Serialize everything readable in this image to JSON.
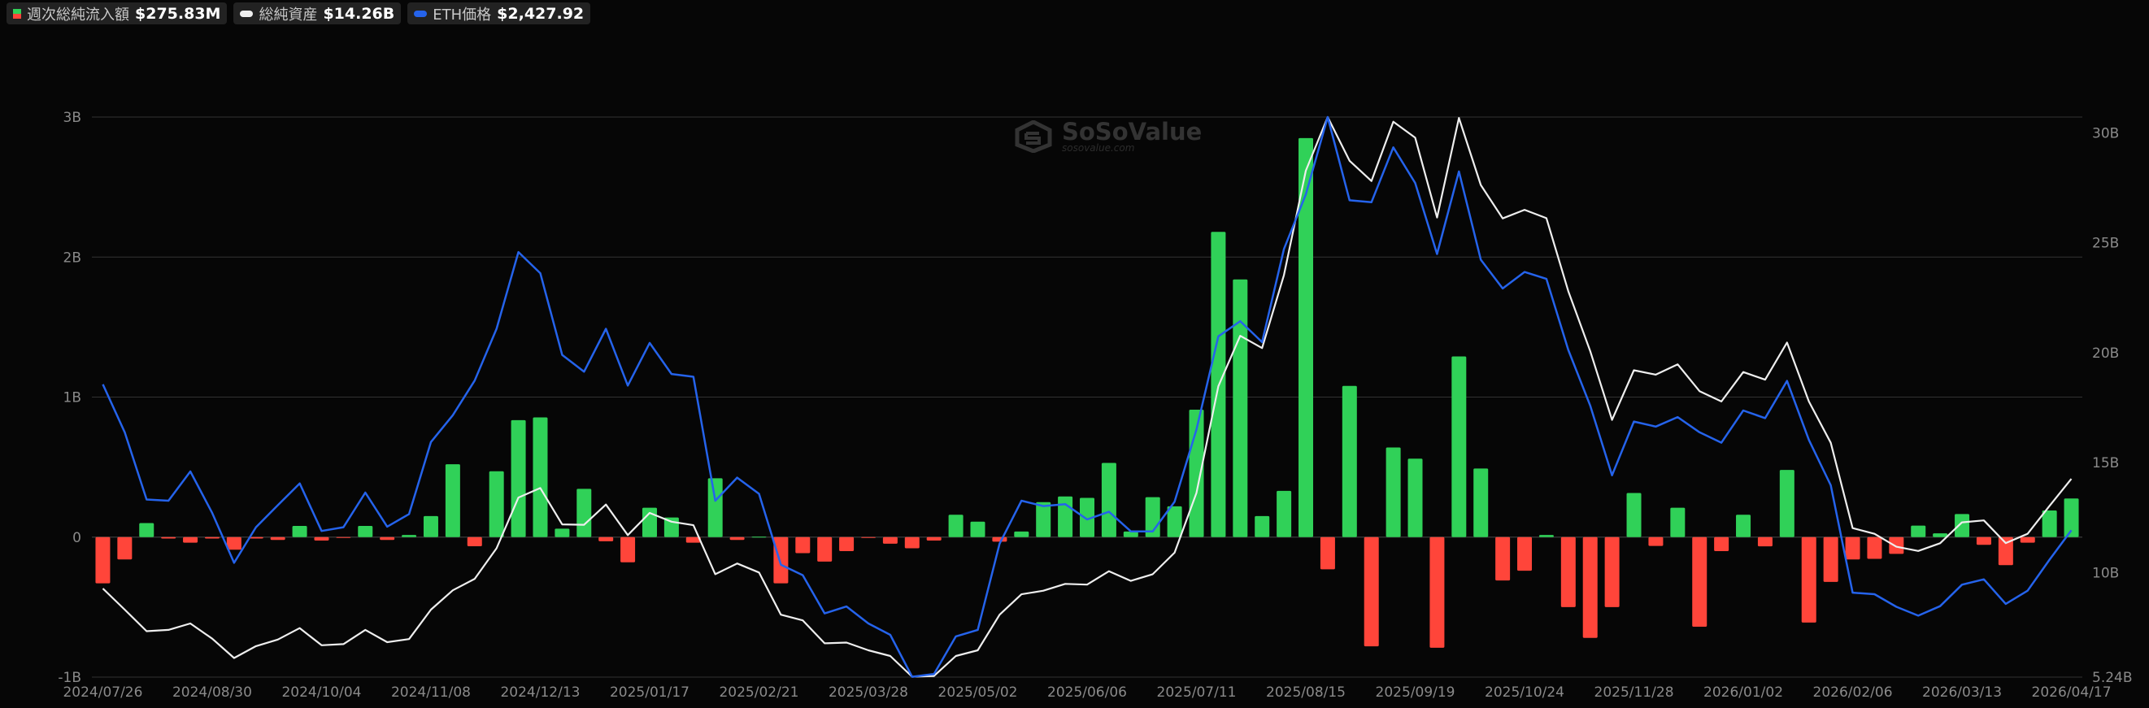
{
  "legend": [
    {
      "label": "週次総純流入額",
      "value": "$275.83M"
    },
    {
      "label": "総純資産",
      "value": "$14.26B"
    },
    {
      "label": "ETH価格",
      "value": "$2,427.92"
    }
  ],
  "watermark": {
    "brand": "SoSoValue",
    "site": "sosovalue.com"
  },
  "colors": {
    "inflow": "#30d158",
    "outflow": "#ff453a",
    "assets": "#eeeeee",
    "eth": "#2563eb",
    "grid": "#333333",
    "background": "#060606"
  },
  "chart_data": {
    "type": "bar+line",
    "title": "",
    "xlabel": "",
    "ylabel": "",
    "grid": true,
    "legend_position": "top-left",
    "x_ticks": [
      {
        "week": 0,
        "label": "2024/07/26"
      },
      {
        "week": 5,
        "label": "2024/08/30"
      },
      {
        "week": 10,
        "label": "2024/10/04"
      },
      {
        "week": 15,
        "label": "2024/11/08"
      },
      {
        "week": 20,
        "label": "2024/12/13"
      },
      {
        "week": 25,
        "label": "2025/01/17"
      },
      {
        "week": 30,
        "label": "2025/02/21"
      },
      {
        "week": 35,
        "label": "2025/03/28"
      },
      {
        "week": 40,
        "label": "2025/05/02"
      },
      {
        "week": 45,
        "label": "2025/06/06"
      },
      {
        "week": 50,
        "label": "2025/07/11"
      },
      {
        "week": 55,
        "label": "2025/08/15"
      },
      {
        "week": 60,
        "label": "2025/09/19"
      },
      {
        "week": 65,
        "label": "2025/10/24"
      },
      {
        "week": 70,
        "label": "2025/11/28"
      },
      {
        "week": 75,
        "label": "2026/01/02"
      },
      {
        "week": 80,
        "label": "2026/02/06"
      },
      {
        "week": 85,
        "label": "2026/03/13"
      },
      {
        "week": 90,
        "label": "2026/04/17"
      }
    ],
    "left_axis": {
      "ylim": [
        -1,
        3
      ],
      "ticks": [
        {
          "v": 3,
          "label": "3B"
        },
        {
          "v": 2,
          "label": "2B"
        },
        {
          "v": 1,
          "label": "1B"
        },
        {
          "v": 0,
          "label": "0"
        },
        {
          "v": -1,
          "label": "-1B"
        }
      ]
    },
    "right_axis": {
      "ylim": [
        5.24,
        30.72
      ],
      "ticks": [
        {
          "v": 30,
          "label": "30B"
        },
        {
          "v": 25,
          "label": "25B"
        },
        {
          "v": 20,
          "label": "20B"
        },
        {
          "v": 15,
          "label": "15B"
        },
        {
          "v": 10,
          "label": "10B"
        },
        {
          "v": 5.24,
          "label": "5.24B"
        }
      ]
    },
    "eth_axis": {
      "ylim": [
        1580,
        4815
      ]
    },
    "series": [
      {
        "name": "週次総純流入額",
        "type": "bar",
        "axis": "left",
        "unit": "B USD",
        "values": [
          -0.33,
          -0.16,
          0.1,
          -0.01,
          -0.04,
          -0.01,
          -0.09,
          -0.01,
          -0.02,
          0.08,
          -0.025,
          -0.005,
          0.08,
          -0.02,
          0.015,
          0.15,
          0.52,
          -0.065,
          0.47,
          0.835,
          0.855,
          0.06,
          0.345,
          -0.03,
          -0.18,
          0.21,
          0.14,
          -0.04,
          0.42,
          -0.02,
          0.003,
          -0.33,
          -0.115,
          -0.175,
          -0.1,
          -0.005,
          -0.047,
          -0.08,
          -0.025,
          0.16,
          0.11,
          -0.033,
          0.04,
          0.25,
          0.29,
          0.28,
          0.53,
          0.04,
          0.285,
          0.22,
          0.91,
          2.18,
          1.84,
          0.15,
          0.33,
          2.85,
          -0.23,
          1.08,
          -0.78,
          0.64,
          0.56,
          -0.79,
          1.29,
          0.49,
          -0.31,
          -0.24,
          0.015,
          -0.5,
          -0.72,
          -0.5,
          0.315,
          -0.063,
          0.21,
          -0.64,
          -0.1,
          0.16,
          -0.066,
          0.48,
          -0.61,
          -0.32,
          -0.16,
          -0.155,
          -0.12,
          0.082,
          0.027,
          0.165,
          -0.055,
          -0.2,
          -0.04,
          0.19,
          0.276
        ]
      },
      {
        "name": "総純資産",
        "type": "line",
        "axis": "right",
        "unit": "B USD",
        "values": [
          9.27,
          8.31,
          7.33,
          7.39,
          7.68,
          6.99,
          6.11,
          6.65,
          6.95,
          7.47,
          6.69,
          6.74,
          7.39,
          6.83,
          6.97,
          8.31,
          9.19,
          9.71,
          11.1,
          13.41,
          13.84,
          12.19,
          12.17,
          13.09,
          11.7,
          12.71,
          12.31,
          12.15,
          9.92,
          10.41,
          10.0,
          8.08,
          7.82,
          6.78,
          6.81,
          6.46,
          6.2,
          5.26,
          5.29,
          6.2,
          6.46,
          8.08,
          9.01,
          9.17,
          9.48,
          9.45,
          10.06,
          9.62,
          9.92,
          10.9,
          13.62,
          18.47,
          20.77,
          20.21,
          23.53,
          28.28,
          30.72,
          28.73,
          27.81,
          30.51,
          29.78,
          26.15,
          30.68,
          27.63,
          26.11,
          26.5,
          26.12,
          22.8,
          20.08,
          16.94,
          19.2,
          19.0,
          19.47,
          18.25,
          17.78,
          19.12,
          18.77,
          20.46,
          17.78,
          15.9,
          12.02,
          11.76,
          11.17,
          10.98,
          11.33,
          12.28,
          12.37,
          11.34,
          11.76,
          13.03,
          14.26
        ]
      },
      {
        "name": "ETH価格",
        "type": "line",
        "axis": "eth",
        "unit": "USD",
        "values": [
          3271,
          2994,
          2606,
          2599,
          2768,
          2528,
          2240,
          2446,
          2573,
          2699,
          2424,
          2446,
          2646,
          2449,
          2522,
          2938,
          3093,
          3293,
          3592,
          4035,
          3913,
          3441,
          3344,
          3592,
          3264,
          3510,
          3331,
          3315,
          2599,
          2732,
          2639,
          2229,
          2169,
          1948,
          1988,
          1890,
          1824,
          1582,
          1598,
          1815,
          1853,
          2351,
          2599,
          2568,
          2579,
          2491,
          2535,
          2422,
          2422,
          2593,
          3010,
          3548,
          3636,
          3515,
          4053,
          4368,
          4815,
          4334,
          4323,
          4640,
          4434,
          4024,
          4501,
          3991,
          3825,
          3920,
          3880,
          3470,
          3149,
          2746,
          3056,
          3027,
          3082,
          2994,
          2934,
          3120,
          3076,
          3291,
          2950,
          2688,
          2068,
          2059,
          1986,
          1935,
          1990,
          2114,
          2145,
          2003,
          2079,
          2258,
          2427.92
        ]
      }
    ]
  }
}
